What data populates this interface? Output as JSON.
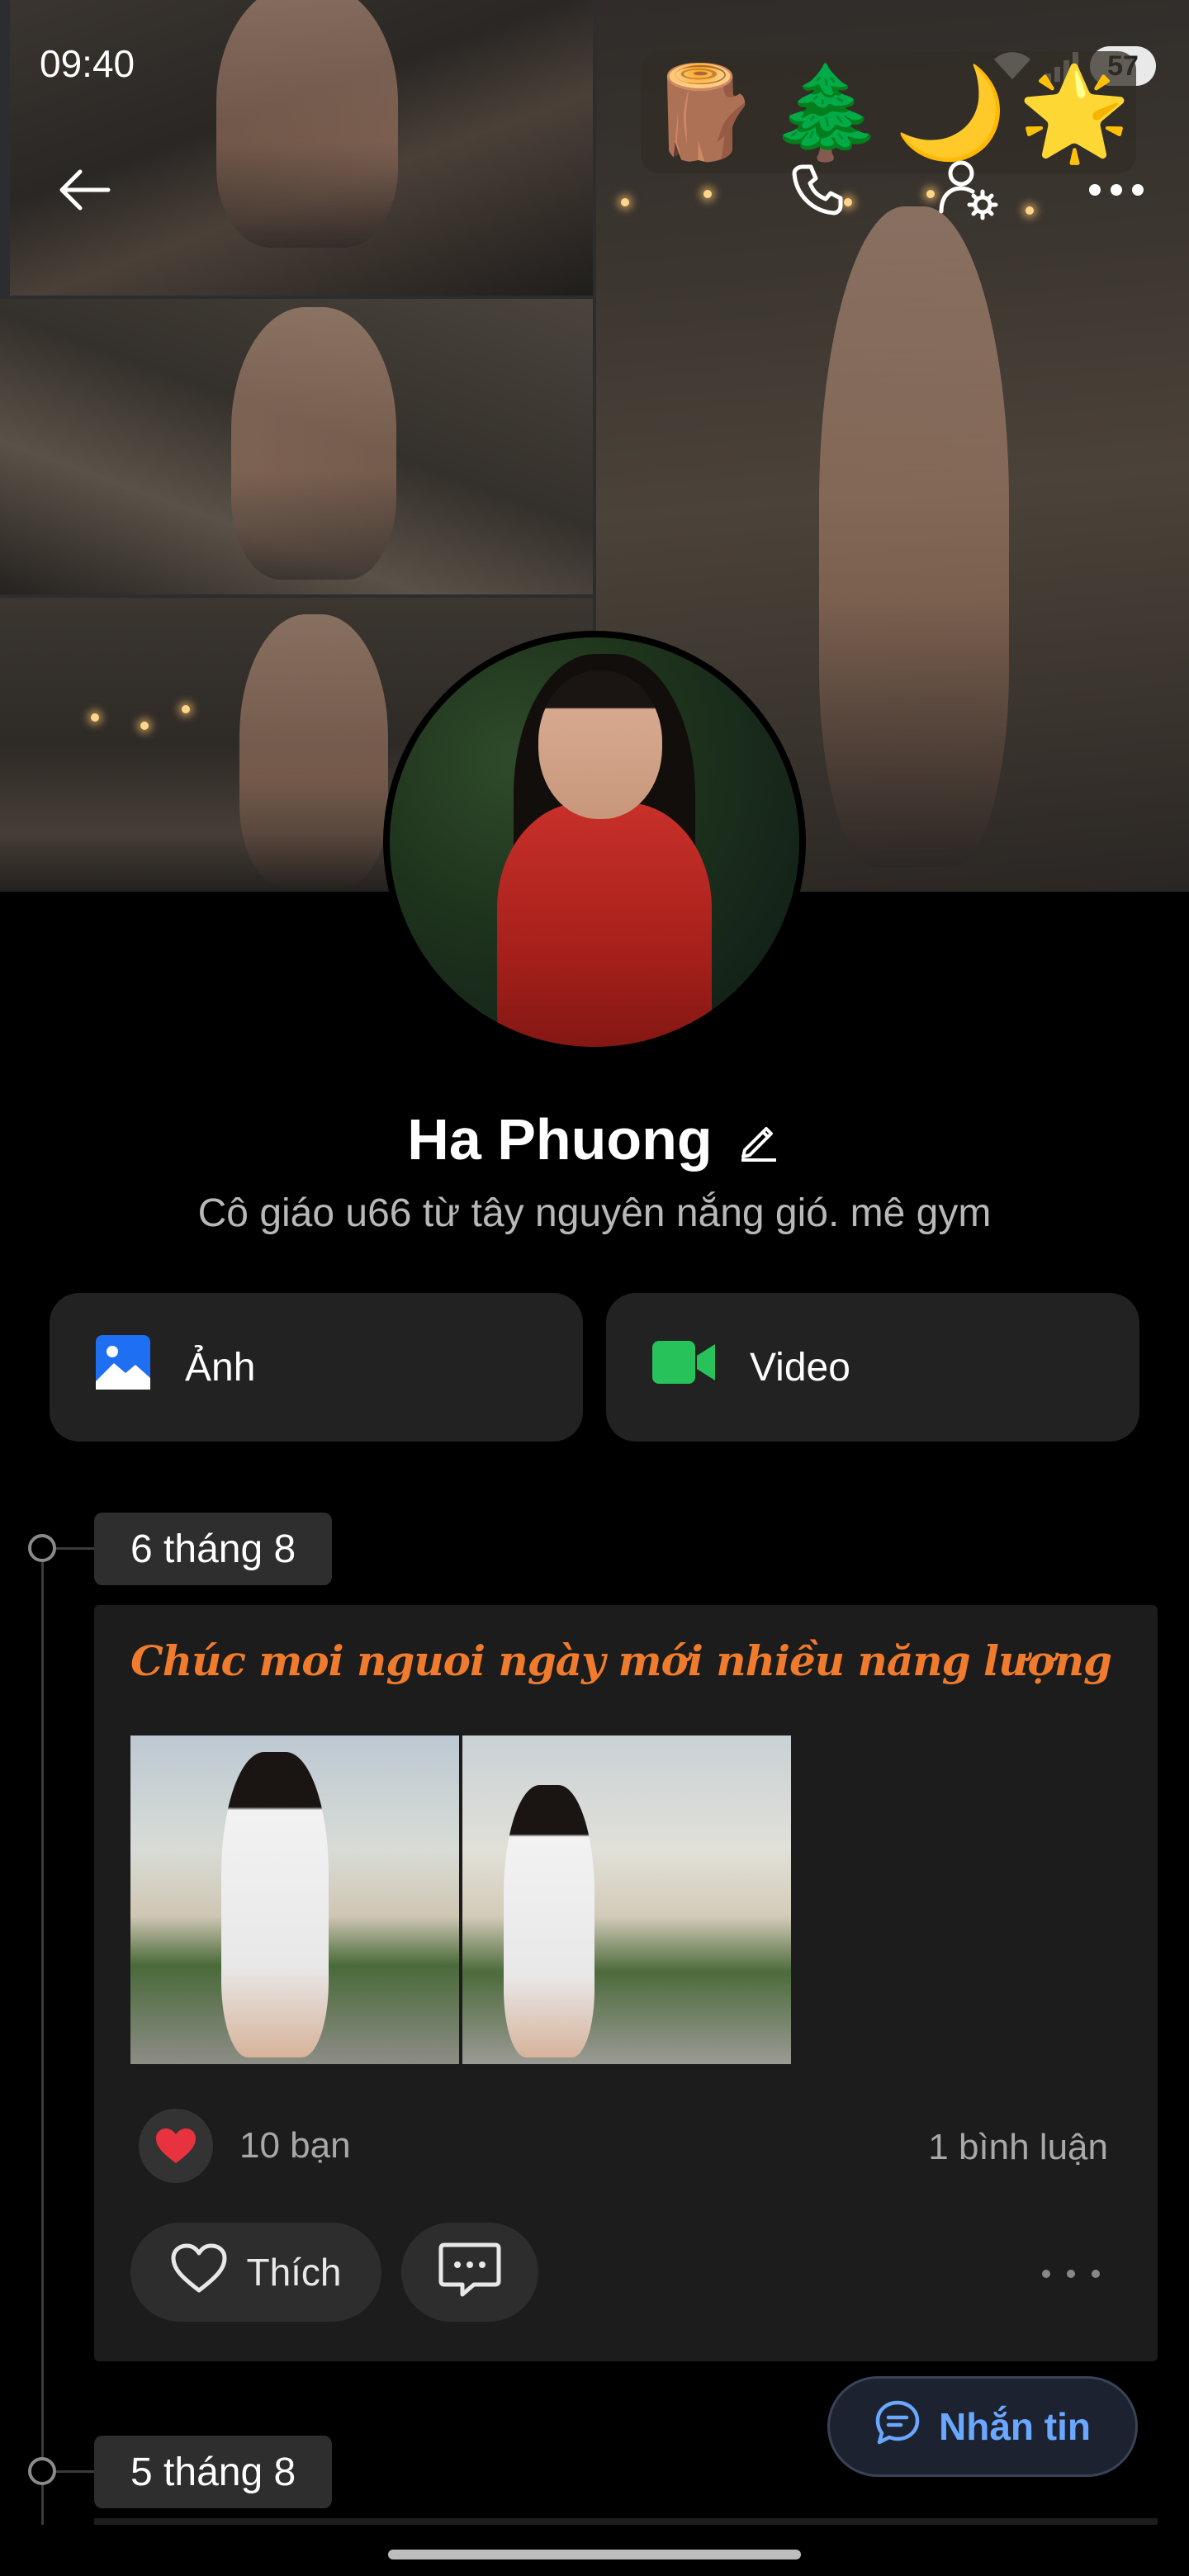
{
  "status_bar": {
    "time": "09:40",
    "battery": "57"
  },
  "cover": {
    "emoji_strip": [
      "🪵",
      "🌲",
      "🌙",
      "🌟"
    ]
  },
  "profile": {
    "name": "Ha Phuong",
    "bio": "Cô giáo u66 từ tây nguyên nắng gió. mê gym"
  },
  "media_buttons": {
    "photo_label": "Ảnh",
    "video_label": "Video"
  },
  "timeline": {
    "dates": [
      "6 tháng 8",
      "5 tháng 8"
    ],
    "post": {
      "title": "Chúc moi nguoi ngày mới nhiều năng lượng",
      "reaction_count": "10 bạn",
      "comment_count": "1 bình luận",
      "like_label": "Thích"
    }
  },
  "floating": {
    "message_label": "Nhắn tin"
  },
  "colors": {
    "accent_blue": "#6aa7ff",
    "post_title_orange": "#f07b2c",
    "photo_icon": "#1e6ff2",
    "video_icon": "#27c25a",
    "heart": "#e8323f"
  },
  "icons": [
    "back-arrow-icon",
    "phone-icon",
    "user-settings-icon",
    "more-icon",
    "edit-pencil-icon",
    "photo-icon",
    "video-camera-icon",
    "heart-icon",
    "comment-icon",
    "chat-icon"
  ]
}
